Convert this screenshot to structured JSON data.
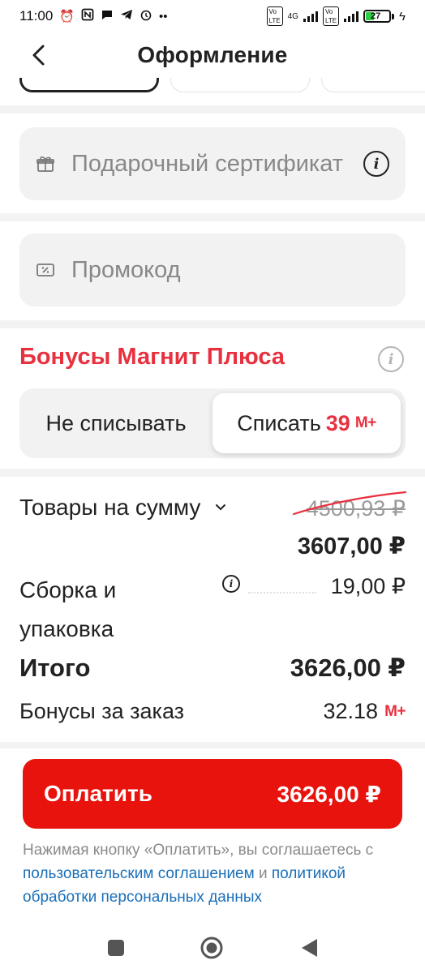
{
  "status_bar": {
    "time": "11:00",
    "network": "4G",
    "battery": "27"
  },
  "header": {
    "title": "Оформление"
  },
  "fields": {
    "gift_certificate_placeholder": "Подарочный сертификат",
    "promo_placeholder": "Промокод"
  },
  "bonuses": {
    "title": "Бонусы Магнит Плюса",
    "option_keep": "Не списывать",
    "option_spend_label": "Списать",
    "option_spend_amount": "39",
    "mplus": "М+",
    "selected": "spend"
  },
  "summary": {
    "goods_label": "Товары на сумму",
    "goods_old_price": "4500,93 ₽",
    "goods_new_price": "3607,00 ₽",
    "packing_label_line1": "Сборка и",
    "packing_label_line2": "упаковка",
    "packing_price": "19,00 ₽",
    "total_label": "Итого",
    "total_price": "3626,00 ₽",
    "order_bonus_label": "Бонусы за заказ",
    "order_bonus_value": "32.18"
  },
  "pay_button": {
    "label": "Оплатить",
    "amount": "3626,00 ₽"
  },
  "legal": {
    "text_before": "Нажимая кнопку «Оплатить», вы соглашаетесь с ",
    "link_agreement": "пользовательским соглашением",
    "text_and": " и ",
    "link_privacy": "политикой обработки персональных данных"
  },
  "colors": {
    "accent_red": "#e8313f",
    "pay_button": "#e8130d",
    "link": "#1a6fb8"
  }
}
